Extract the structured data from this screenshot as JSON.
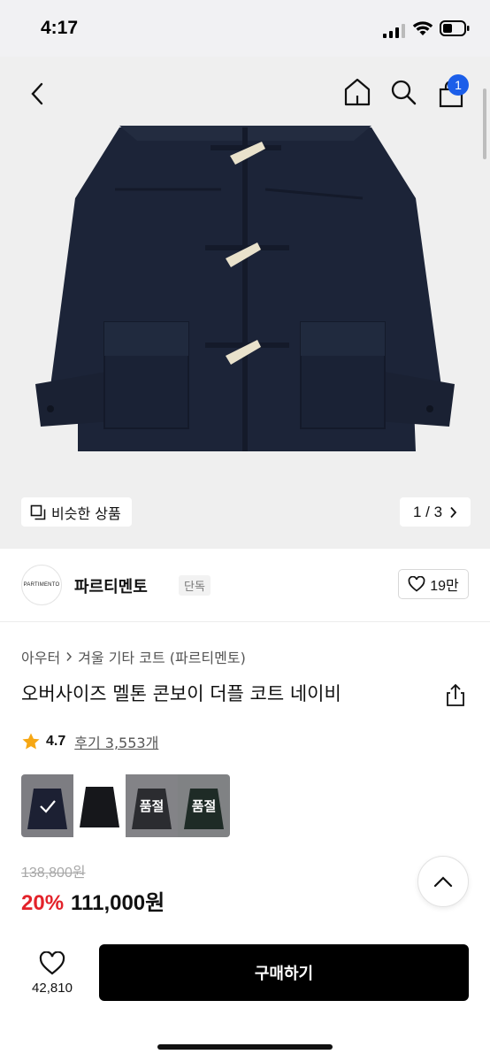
{
  "status_bar": {
    "time": "4:17"
  },
  "nav": {
    "cart_count": "1"
  },
  "hero": {
    "similar_label": "비슷한 상품",
    "pager": "1 / 3"
  },
  "brand": {
    "logo_text": "PARTIMENTO",
    "name": "파르티멘토",
    "tag": "단독",
    "likes": "19만"
  },
  "product": {
    "breadcrumb": [
      "아우터",
      "겨울 기타 코트 (파르티멘토)"
    ],
    "title": "오버사이즈 멜톤 콘보이 더플 코트 네이비",
    "rating": "4.7",
    "reviews": "후기 3,553개",
    "swatches": [
      {
        "label": "",
        "selected": true,
        "color": "#1c2033"
      },
      {
        "label": "",
        "selected": false,
        "color": "#ffffff"
      },
      {
        "label": "품절",
        "selected": false,
        "color": "#2b2c30"
      },
      {
        "label": "품절",
        "selected": false,
        "color": "#1e2b26"
      }
    ],
    "original_price": "138,800원",
    "discount": "20%",
    "sale_price": "111,000원"
  },
  "bottom": {
    "like_count": "42,810",
    "buy_label": "구매하기"
  },
  "colors": {
    "accent_red": "#e3222a",
    "badge_blue": "#1b5ee9",
    "coat_navy": "#1c2438"
  }
}
